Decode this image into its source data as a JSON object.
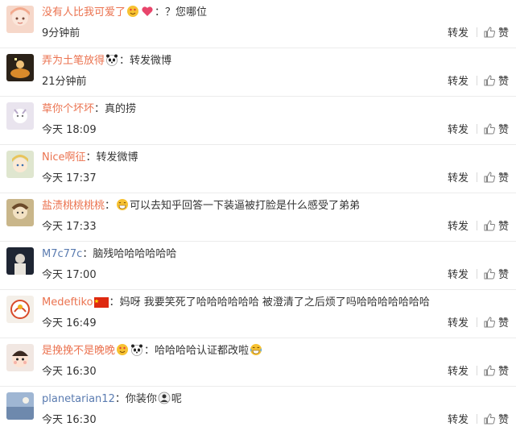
{
  "comments": [
    {
      "user": "没有人比我可爱了",
      "text": "？您哪位",
      "time": "9分钟前"
    },
    {
      "user": "弄为土笔放得",
      "text": "转发微博",
      "time": "21分钟前"
    },
    {
      "user": "草你个坏坏",
      "text": "真的捞",
      "time": "今天 18:09"
    },
    {
      "user": "Nice啊征",
      "text": "转发微博",
      "time": "今天 17:37"
    },
    {
      "user": "盐渍桃桃桃桃",
      "text": "可以去知乎回答一下装逼被打脸是什么感受了弟弟",
      "time": "今天 17:33"
    },
    {
      "user": "M7c77c",
      "text": "脑残哈哈哈哈哈哈",
      "time": "今天 17:00"
    },
    {
      "user": "Medeftiko",
      "text": "妈呀 我要笑死了哈哈哈哈哈哈 被澄清了之后烦了吗哈哈哈哈哈哈哈",
      "time": "今天 16:49"
    },
    {
      "user": "是挽挽不是晚晚",
      "text": "哈哈哈哈认证都改啦",
      "time": "今天 16:30"
    },
    {
      "user": "planetarian12",
      "text": "你装你",
      "text_after": "呢",
      "time": "今天 16:30"
    }
  ],
  "actions": {
    "forward": "转发",
    "like": "赞"
  },
  "icons": {
    "like": "thumbs-up-icon",
    "emoji_love": "heart-eyes-emoji-icon",
    "emoji_heart": "heart-emoji-icon",
    "emoji_panda": "panda-emoji-icon",
    "emoji_grin": "grin-emoji-icon",
    "emoji_laugh_cry": "laugh-cry-emoji-icon",
    "emoji_person": "person-emoji-icon",
    "flag": "china-flag-icon"
  },
  "colors": {
    "username": "#eb7350",
    "username_alt": "#5a7bb0",
    "text": "#333333",
    "divider": "#ebebeb"
  }
}
